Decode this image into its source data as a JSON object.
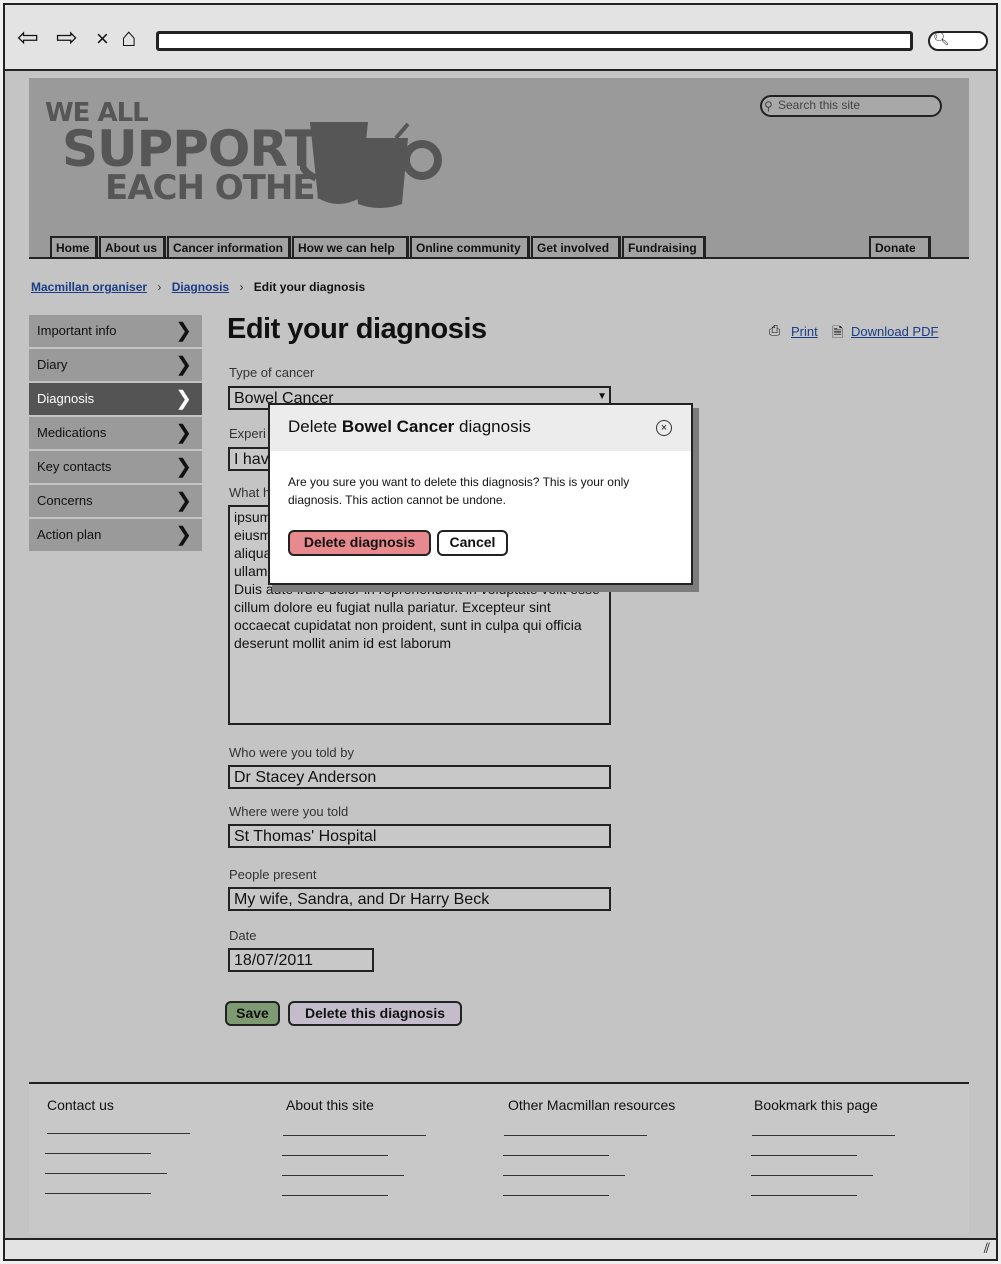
{
  "site": {
    "logo_lines": [
      "WE ALL",
      "SUPPORT",
      "EACH OTHER"
    ],
    "search_placeholder": "Search this site"
  },
  "nav": {
    "tabs": [
      "Home",
      "About us",
      "Cancer information",
      "How we can help",
      "Online community",
      "Get involved",
      "Fundraising"
    ],
    "donate": "Donate"
  },
  "breadcrumb": {
    "items": [
      "Macmillan organiser",
      "Diagnosis"
    ],
    "current": "Edit your diagnosis"
  },
  "sidebar": {
    "items": [
      {
        "label": "Important info"
      },
      {
        "label": "Diary"
      },
      {
        "label": "Diagnosis",
        "active": true
      },
      {
        "label": "Medications"
      },
      {
        "label": "Key contacts"
      },
      {
        "label": "Concerns"
      },
      {
        "label": "Action plan"
      }
    ]
  },
  "page": {
    "title": "Edit your diagnosis",
    "print": "Print",
    "download_pdf": "Download PDF"
  },
  "form": {
    "type_label": "Type of cancer",
    "type_value": "Bowel Cancer",
    "exp_label": "Experi",
    "exp_value": "I hav",
    "what_label": "What h",
    "what_lines": [
      " ipsum",
      "eiusm",
      "aliqua",
      "ullam",
      "Duis aute irure dolor in reprehenderit in voluptate velit esse",
      "cillum dolore eu fugiat nulla pariatur. Excepteur sint",
      "occaecat cupidatat non proident, sunt in culpa qui officia",
      "deserunt mollit anim id est laborum"
    ],
    "told_by_label": "Who were you told by",
    "told_by_value": "Dr Stacey Anderson",
    "where_label": "Where were you told",
    "where_value": "St Thomas' Hospital",
    "people_label": "People present",
    "people_value": "My wife, Sandra, and Dr Harry Beck",
    "date_label": "Date",
    "date_value": "18/07/2011",
    "save": "Save",
    "delete": "Delete this diagnosis"
  },
  "dialog": {
    "title_prefix": "Delete ",
    "title_bold": "Bowel Cancer",
    "title_suffix": " diagnosis",
    "close": "×",
    "message": "Are you sure you want to delete this diagnosis? This is your only diagnosis. This action cannot be undone.",
    "confirm": "Delete diagnosis",
    "cancel": "Cancel"
  },
  "footer": {
    "columns": [
      "Contact us",
      "About this site",
      "Other Macmillan resources",
      "Bookmark this page"
    ]
  },
  "colors": {
    "link": "#1b3c86",
    "save_button": "#7e9a72",
    "delete_button": "#c4bccb",
    "confirm_button": "#e8898e"
  }
}
